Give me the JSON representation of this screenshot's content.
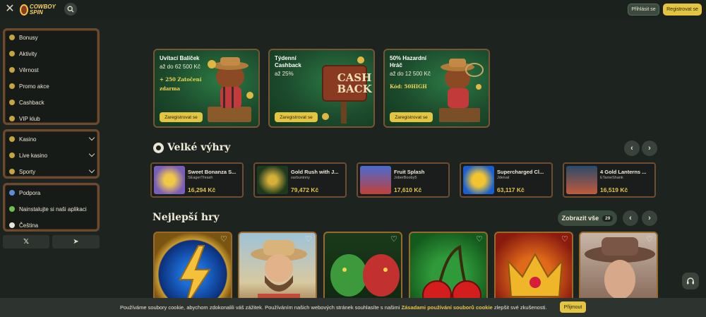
{
  "header": {
    "logo_text": "COWBOY SPIN",
    "login_label": "Přihlásit se",
    "register_label": "Registrovat se"
  },
  "sidebar": {
    "promo_items": [
      {
        "label": "Bonusy",
        "icon": "coin-icon"
      },
      {
        "label": "Aktivity",
        "icon": "star-icon"
      },
      {
        "label": "Věrnost",
        "icon": "crown-icon"
      },
      {
        "label": "Promo akce",
        "icon": "gift-icon"
      },
      {
        "label": "Cashback",
        "icon": "cashback-icon"
      },
      {
        "label": "VIP klub",
        "icon": "vip-icon"
      }
    ],
    "game_items": [
      {
        "label": "Kasino",
        "icon": "casino-icon"
      },
      {
        "label": "Live kasino",
        "icon": "live-icon"
      },
      {
        "label": "Sporty",
        "icon": "sports-icon"
      }
    ],
    "misc_items": [
      {
        "label": "Podpora",
        "icon": "support-icon"
      },
      {
        "label": "Nainstalujte si naši aplikaci",
        "icon": "android-icon"
      },
      {
        "label": "Čeština",
        "icon": "flag-cz-icon"
      }
    ],
    "social": {
      "x_label": "𝕏",
      "telegram_label": "➤"
    }
  },
  "promos": [
    {
      "title": "Uvítací Balíček",
      "sub": "až do 62 500 Kč",
      "highlight1": "+ 250 Zatočení",
      "highlight2": "zdarma",
      "cta": "Zaregistrovat se"
    },
    {
      "title": "Týdenní Cashback",
      "sub": "až 25%",
      "highlight1": "",
      "highlight2": "",
      "cta": "Zaregistrovat se",
      "art_text1": "CASH",
      "art_text2": "BACK"
    },
    {
      "title": "50% Hazardní Hráč",
      "sub": "až do 12 500 Kč",
      "highlight1": "Kód: 50HIGH",
      "highlight2": "",
      "cta": "Zaregistrovat se"
    }
  ],
  "big_wins": {
    "title": "Velké výhry",
    "items": [
      {
        "game": "Sweet Bonanza S...",
        "user": "SEagerThrash",
        "amount": "16,294 Kč"
      },
      {
        "game": "Gold Rush with J...",
        "user": "sarbuninny",
        "amount": "79,472 Kč"
      },
      {
        "game": "Fruit Splash",
        "user": "JoberBooby5",
        "amount": "17,610 Kč"
      },
      {
        "game": "Supercharged Cl...",
        "user": "Jdeival",
        "amount": "63,117 Kč"
      },
      {
        "game": "4 Gold Lanterns ...",
        "user": "ETameShank",
        "amount": "16,519 Kč"
      }
    ]
  },
  "best_games": {
    "title": "Nejlepší hry",
    "show_all_label": "Zobrazit vše",
    "count": "29"
  },
  "cookie": {
    "text_before": "Používáme soubory cookie, abychom zdokonalili váš zážitek. Používáním našich webových stránek souhlasíte s našimi ",
    "link": "Zásadami používání souborů cookie",
    "text_after": " zlepšit své zkušenosti.",
    "accept_label": "Přijmout"
  }
}
